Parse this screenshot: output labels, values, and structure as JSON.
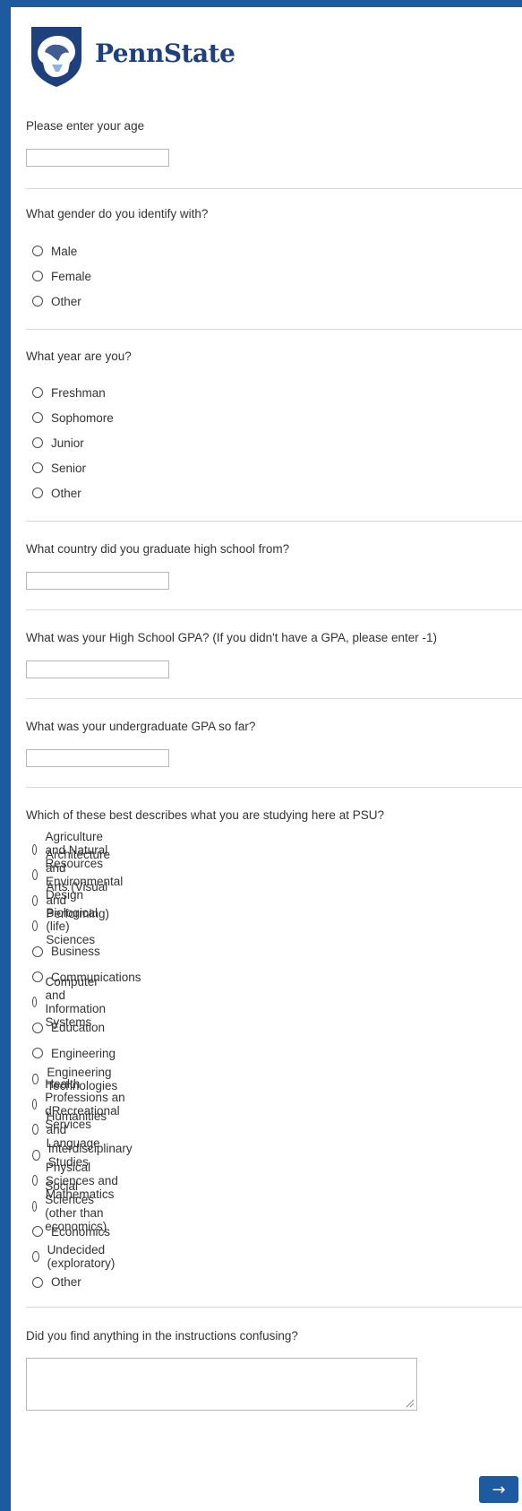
{
  "brand": {
    "name": "PennState",
    "logo_icon": "nittany-lion-shield-icon",
    "color": "#1e407c",
    "accent": "#1e5aa0"
  },
  "questions": {
    "age": {
      "text": "Please enter your age",
      "value": ""
    },
    "gender": {
      "text": "What gender do you identify with?",
      "options": [
        "Male",
        "Female",
        "Other"
      ]
    },
    "year": {
      "text": "What year are you?",
      "options": [
        "Freshman",
        "Sophomore",
        "Junior",
        "Senior",
        "Other"
      ]
    },
    "country": {
      "text": "What country did you graduate high school from?",
      "value": ""
    },
    "hs_gpa": {
      "text": "What was your High School GPA? (If you didn't have a GPA, please enter -1)",
      "value": ""
    },
    "ug_gpa": {
      "text": "What was your undergraduate GPA so far?",
      "value": ""
    },
    "major": {
      "text": "Which of these best describes what you are studying here at PSU?",
      "options": [
        "Agriculture and Natural Resources",
        "Architecture and Environmental Design",
        "Arts (Visual and Performing)",
        "Biological (life) Sciences",
        "Business",
        "Communications",
        "Computer and Information Systems",
        "Education",
        "Engineering",
        "Engineering Technologies",
        "Health Professions an dRecreational Services",
        "Humanities and Language",
        "Interdisciplinary Studies",
        "Physical Sciences and Mathematics",
        "Social Sciences (other than economics)",
        "Economics",
        "Undecided (exploratory)",
        "Other"
      ]
    },
    "confusing": {
      "text": "Did you find anything in the instructions confusing?",
      "value": ""
    }
  },
  "navigation": {
    "next_label": "→",
    "next_icon": "arrow-right-icon"
  }
}
